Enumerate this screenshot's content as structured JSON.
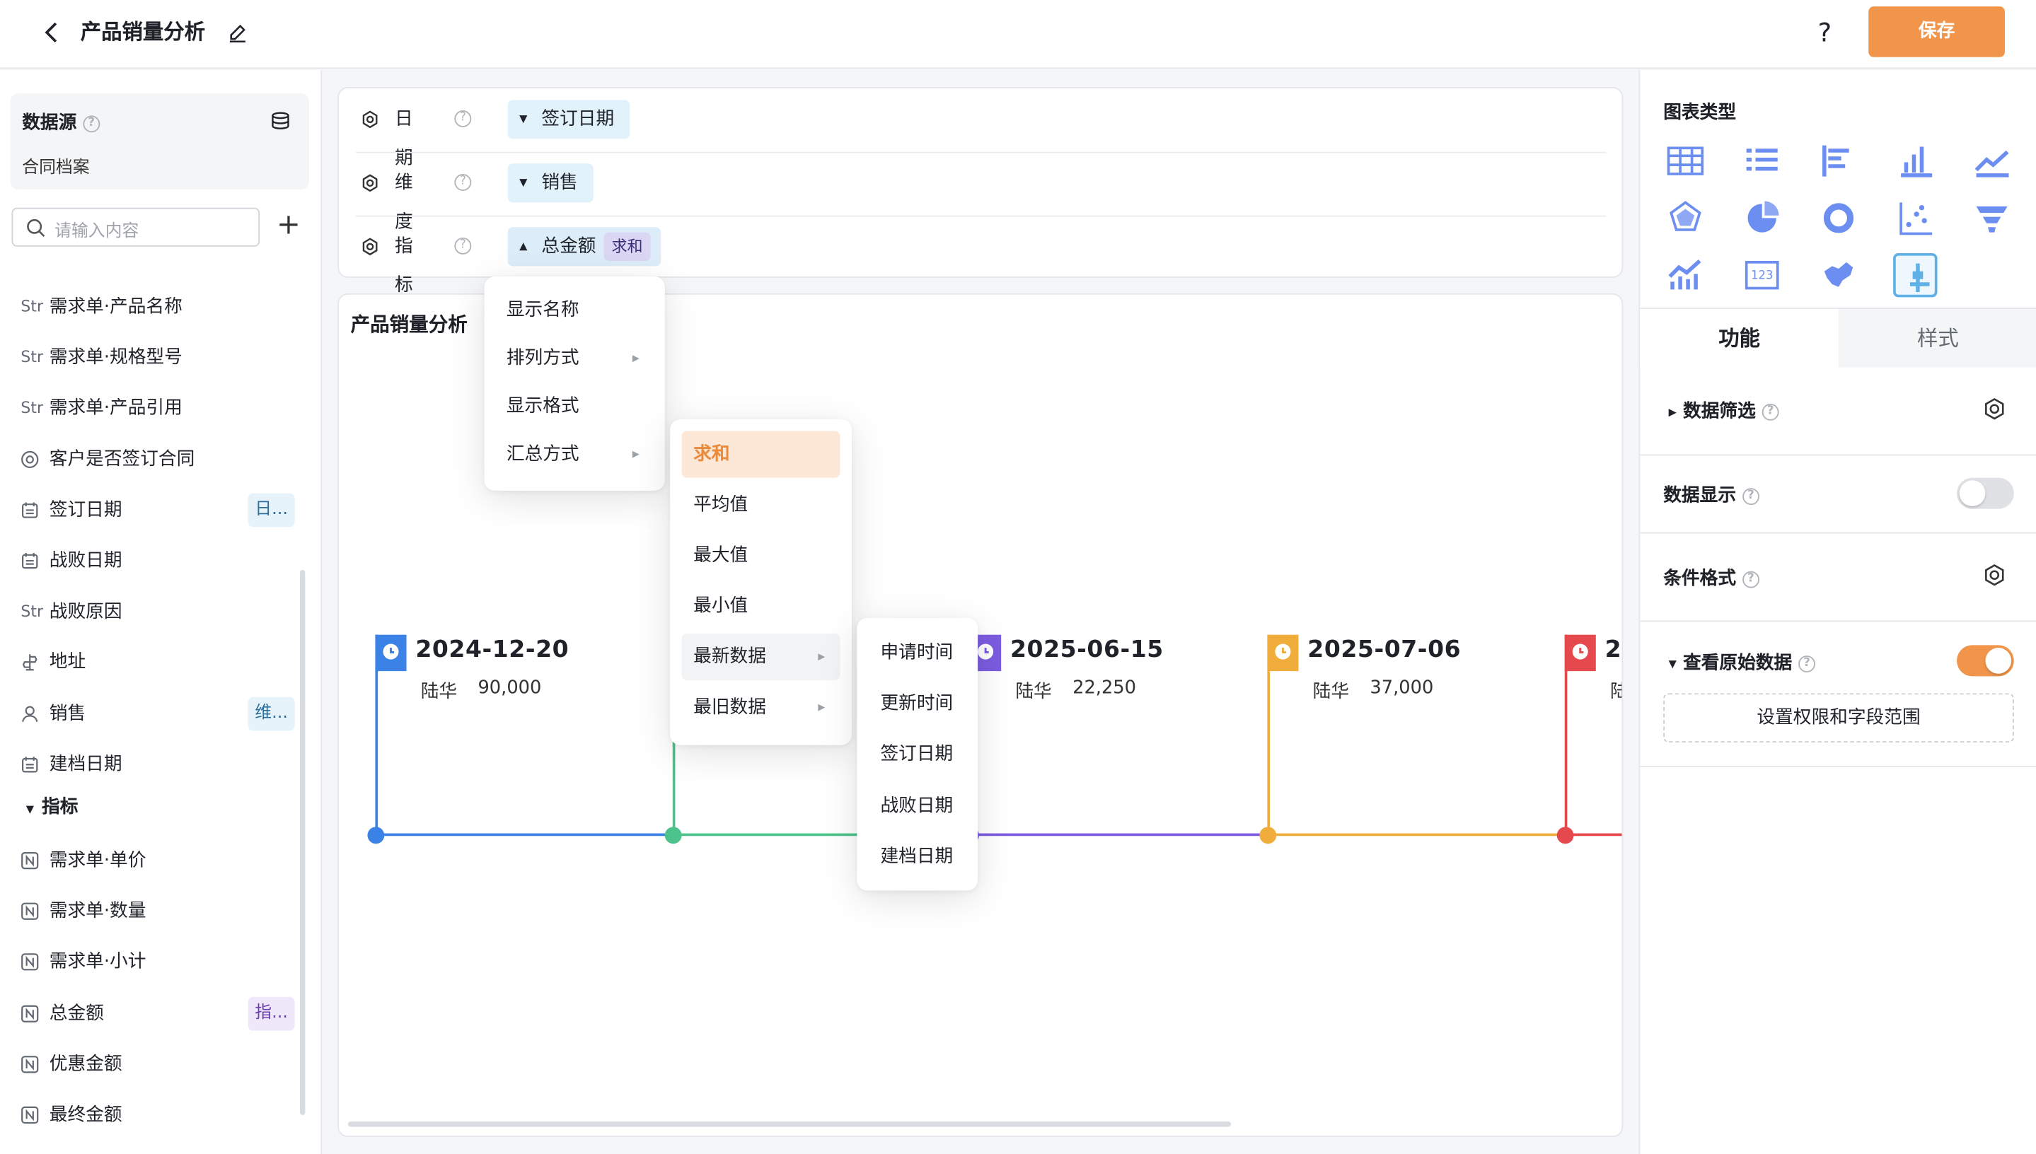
{
  "header": {
    "title": "产品销量分析",
    "help": "?",
    "save_label": "保存"
  },
  "datasource": {
    "title": "数据源",
    "name": "合同档案"
  },
  "search": {
    "placeholder": "请输入内容"
  },
  "fields": [
    {
      "type": "Str",
      "label": "需求单·产品名称"
    },
    {
      "type": "Str",
      "label": "需求单·规格型号"
    },
    {
      "type": "Str",
      "label": "需求单·产品引用"
    },
    {
      "type": "radio",
      "label": "客户是否签订合同"
    },
    {
      "type": "date",
      "label": "签订日期",
      "tag": "日..."
    },
    {
      "type": "date",
      "label": "战败日期"
    },
    {
      "type": "Str",
      "label": "战败原因"
    },
    {
      "type": "location",
      "label": "地址"
    },
    {
      "type": "user",
      "label": "销售",
      "tag": "维..."
    },
    {
      "type": "date",
      "label": "建档日期"
    }
  ],
  "metrics_header": "指标",
  "metrics": [
    {
      "type": "N",
      "label": "需求单·单价"
    },
    {
      "type": "N",
      "label": "需求单·数量"
    },
    {
      "type": "N",
      "label": "需求单·小计"
    },
    {
      "type": "N",
      "label": "总金额",
      "tag": "指..."
    },
    {
      "type": "N",
      "label": "优惠金额"
    },
    {
      "type": "N",
      "label": "最终金额"
    }
  ],
  "config": {
    "date": {
      "label": "日期",
      "value": "签订日期"
    },
    "dimension": {
      "label": "维度",
      "value": "销售"
    },
    "metric": {
      "label": "指标",
      "value": "总金额",
      "agg": "求和"
    }
  },
  "chart": {
    "title": "产品销量分析"
  },
  "timeline": [
    {
      "date": "2024-12-20",
      "name": "陆华",
      "value": "90,000",
      "color": "#3b82e6"
    },
    {
      "date": "",
      "name": "",
      "value": "",
      "color": "#4cc38a"
    },
    {
      "date": "2025-06-15",
      "name": "陆华",
      "value": "22,250",
      "color": "#7c5ce0"
    },
    {
      "date": "2025-07-06",
      "name": "陆华",
      "value": "37,000",
      "color": "#f0ad3c"
    },
    {
      "date": "2",
      "name": "陆",
      "value": "",
      "color": "#e5484d"
    }
  ],
  "menu1": {
    "items": [
      "显示名称",
      "排列方式",
      "显示格式",
      "汇总方式"
    ]
  },
  "menu2": {
    "items": [
      "求和",
      "平均值",
      "最大值",
      "最小值",
      "最新数据",
      "最旧数据"
    ]
  },
  "menu3": {
    "items": [
      "申请时间",
      "更新时间",
      "签订日期",
      "战败日期",
      "建档日期"
    ]
  },
  "right": {
    "chart_types_title": "图表类型",
    "tabs": [
      "功能",
      "样式"
    ],
    "data_filter": "数据筛选",
    "data_display": "数据显示",
    "conditional_format": "条件格式",
    "view_raw": "查看原始数据",
    "perm_button": "设置权限和字段范围",
    "data_display_on": false,
    "view_raw_on": true
  },
  "colors": {
    "accent": "#f0954a",
    "pill_bg": "#e2f2fa",
    "selected_bg": "#fde8d8"
  }
}
